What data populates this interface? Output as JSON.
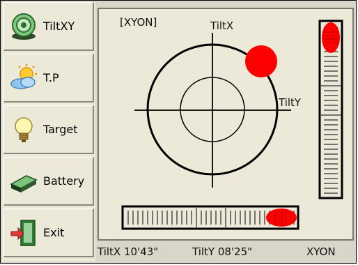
{
  "sidebar": {
    "items": [
      {
        "label": "TiltXY",
        "icon": "tilt-target-icon"
      },
      {
        "label": "T.P",
        "icon": "weather-icon"
      },
      {
        "label": "Target",
        "icon": "lightbulb-icon"
      },
      {
        "label": "Battery",
        "icon": "battery-icon"
      },
      {
        "label": "Exit",
        "icon": "exit-door-icon"
      }
    ]
  },
  "main": {
    "mode_label": "[XYON]",
    "axis_x_label": "TiltX",
    "axis_y_label": "TiltY"
  },
  "status": {
    "tilt_x": "TiltX 10'43\"",
    "tilt_y": "TiltY 08'25\"",
    "mode": "XYON"
  },
  "colors": {
    "bubble": "#ff0000",
    "panel_bg": "#ece9d8"
  }
}
